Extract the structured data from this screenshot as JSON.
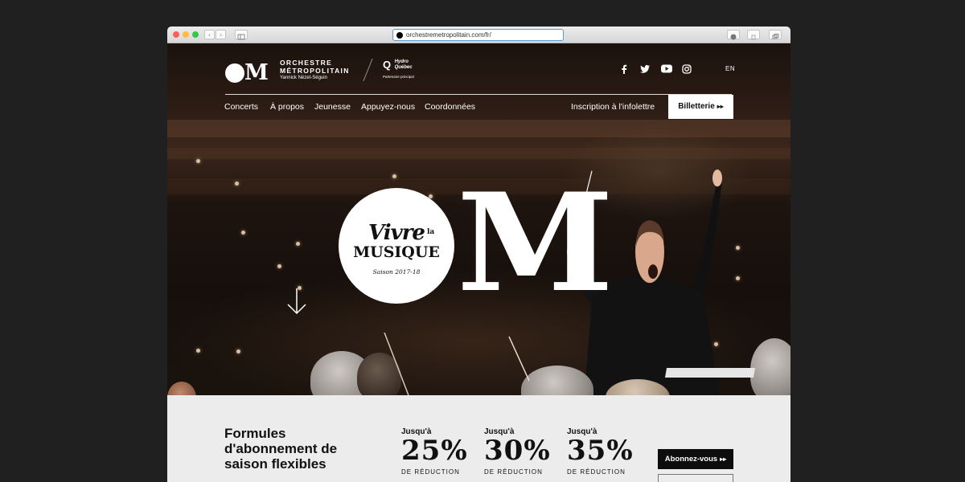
{
  "browser": {
    "url": "orchestremetropolitain.com/fr/",
    "traffic_lights": [
      "#fc605c",
      "#fdbc40",
      "#34c749"
    ]
  },
  "site": {
    "logo": {
      "mark_letter": "M",
      "line1": "ORCHESTRE",
      "line2": "MÉTROPOLITAIN",
      "line3": "Yannick Nézet-Séguin"
    },
    "partner": {
      "q": "Q",
      "name1": "Hydro",
      "name2": "Québec",
      "caption": "Partenaire principal"
    },
    "language": "EN",
    "social_icons": [
      "facebook-icon",
      "twitter-icon",
      "youtube-icon",
      "instagram-icon"
    ],
    "nav": [
      "Concerts",
      "À propos",
      "Jeunesse",
      "Appuyez-nous",
      "Coordonnées"
    ],
    "newsletter": "Inscription à l'infolettre",
    "tickets_button": "Billetterie",
    "tickets_arrow": "▸▸"
  },
  "hero": {
    "badge": {
      "vivre": "Vivre",
      "la": "la",
      "musique": "MUSIQUE",
      "season": "Saison 2017-18"
    },
    "big_letter": "M"
  },
  "offers": {
    "title": "Formules d'abonnement de saison flexibles",
    "items": [
      {
        "upto": "Jusqu'à",
        "pct": "25%",
        "label": "DE RÉDUCTION"
      },
      {
        "upto": "Jusqu'à",
        "pct": "30%",
        "label": "DE RÉDUCTION"
      },
      {
        "upto": "Jusqu'à",
        "pct": "35%",
        "label": "DE RÉDUCTION"
      }
    ],
    "subscribe_button": "Abonnez-vous",
    "subscribe_arrow": "▸▸"
  }
}
